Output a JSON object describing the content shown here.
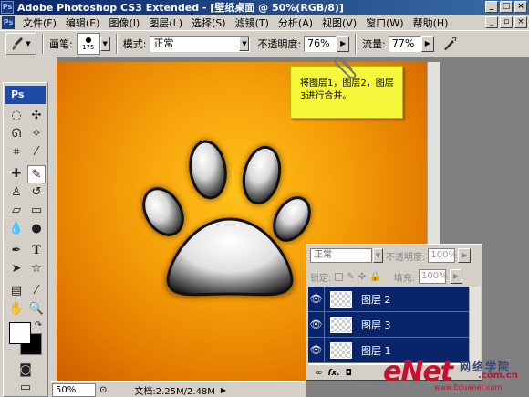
{
  "window": {
    "title": "Adobe Photoshop CS3 Extended - [壁纸桌面 @ 50%(RGB/8)]",
    "app_icon": "Ps"
  },
  "menu": [
    "文件(F)",
    "编辑(E)",
    "图像(I)",
    "图层(L)",
    "选择(S)",
    "滤镜(T)",
    "分析(A)",
    "视图(V)",
    "窗口(W)",
    "帮助(H)"
  ],
  "options": {
    "brush_label": "画笔:",
    "brush_size": "175",
    "mode_label": "模式:",
    "mode_value": "正常",
    "opacity_label": "不透明度:",
    "opacity_value": "76%",
    "flow_label": "流量:",
    "flow_value": "77%"
  },
  "toolbox": {
    "logo": "Ps"
  },
  "note": {
    "text": "将图层1，图层2，图层3进行合并。"
  },
  "layers_panel": {
    "blend_mode": "正常",
    "opacity_label": "不透明度:",
    "opacity_value": "100%",
    "lock_label": "锁定:",
    "fill_label": "填充:",
    "fill_value": "100%",
    "layers": [
      {
        "name": "图层 2",
        "selected": true
      },
      {
        "name": "图层 3",
        "selected": true
      },
      {
        "name": "图层 1",
        "selected": true
      }
    ]
  },
  "status": {
    "zoom": "50%",
    "doc_info": "文档:2.25M/2.48M"
  },
  "watermark": {
    "brand": "eNet",
    "site_cn": "网络学院",
    "domain": ".com.cn",
    "url": "www.Eduenet.com"
  },
  "colors": {
    "selection_blue": "#0a246a",
    "note_yellow": "#f4f73a",
    "canvas_orange": "#f7a30a"
  }
}
